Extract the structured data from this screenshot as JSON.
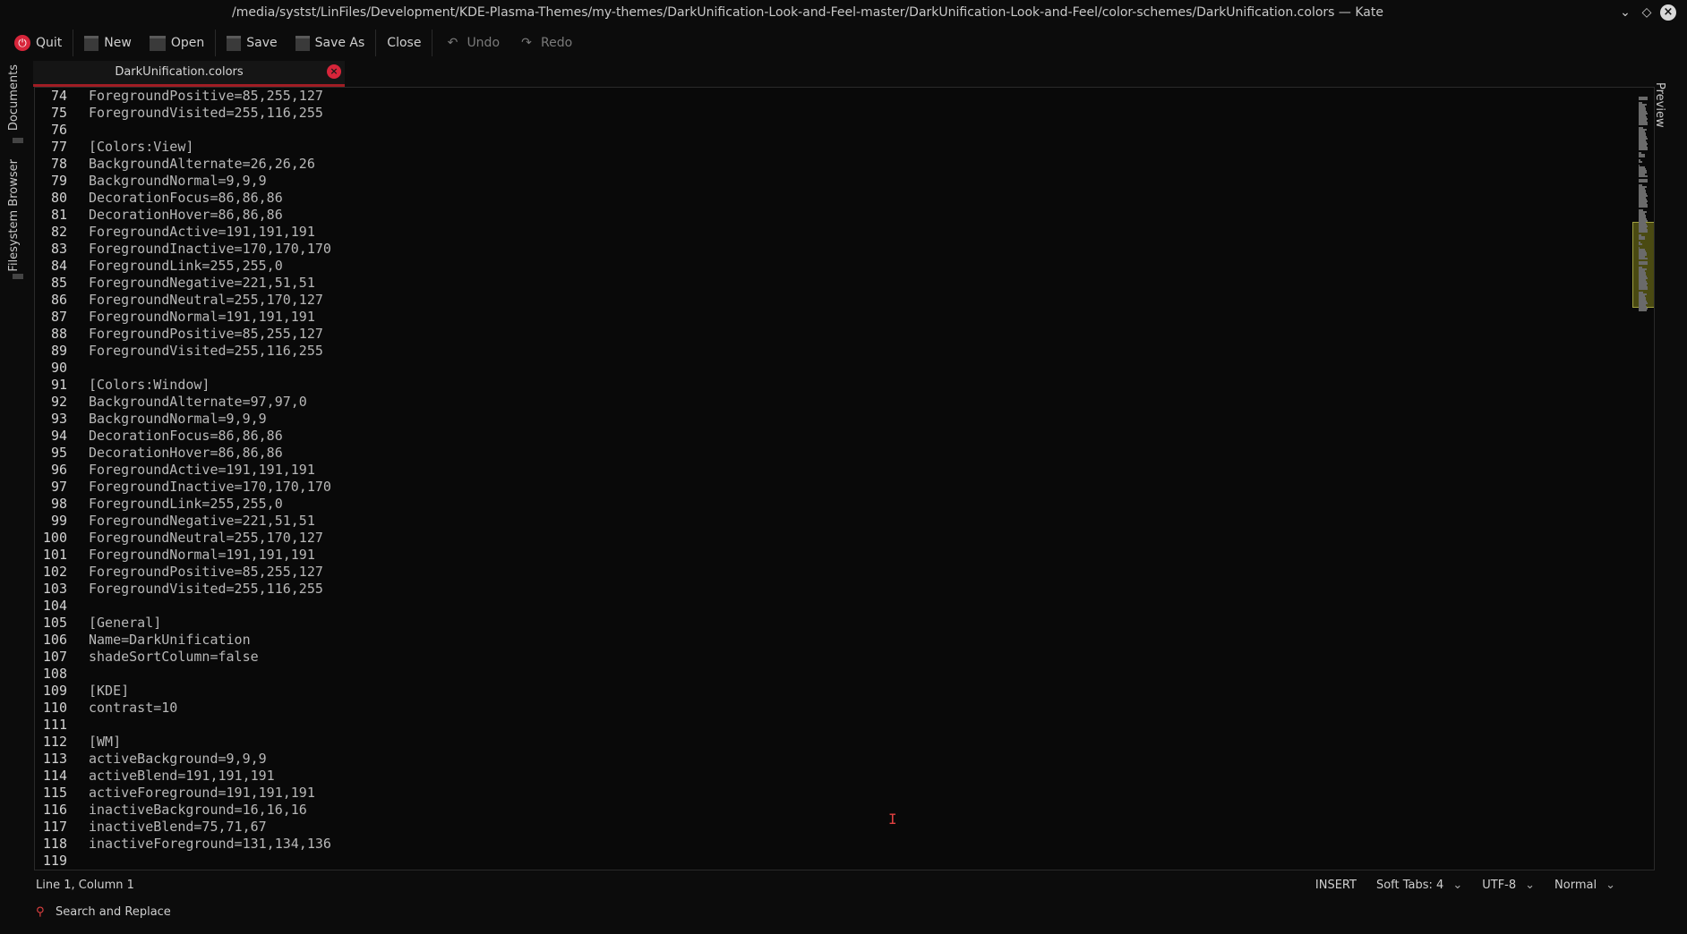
{
  "window": {
    "title": "/media/systst/LinFiles/Development/KDE-Plasma-Themes/my-themes/DarkUnification-Look-and-Feel-master/DarkUnification-Look-and-Feel/color-schemes/DarkUnification.colors — Kate"
  },
  "toolbar": {
    "quit": "Quit",
    "new": "New",
    "open": "Open",
    "save": "Save",
    "save_as": "Save As",
    "close": "Close",
    "undo": "Undo",
    "redo": "Redo"
  },
  "left_panel": {
    "documents": "Documents",
    "filesystem": "Filesystem Browser"
  },
  "right_panel": {
    "preview": "Preview"
  },
  "tab": {
    "label": "DarkUnification.colors"
  },
  "editor": {
    "lines": [
      {
        "n": "74",
        "t": "ForegroundPositive=85,255,127"
      },
      {
        "n": "75",
        "t": "ForegroundVisited=255,116,255"
      },
      {
        "n": "76",
        "t": ""
      },
      {
        "n": "77",
        "t": "[Colors:View]"
      },
      {
        "n": "78",
        "t": "BackgroundAlternate=26,26,26"
      },
      {
        "n": "79",
        "t": "BackgroundNormal=9,9,9"
      },
      {
        "n": "80",
        "t": "DecorationFocus=86,86,86"
      },
      {
        "n": "81",
        "t": "DecorationHover=86,86,86"
      },
      {
        "n": "82",
        "t": "ForegroundActive=191,191,191"
      },
      {
        "n": "83",
        "t": "ForegroundInactive=170,170,170"
      },
      {
        "n": "84",
        "t": "ForegroundLink=255,255,0"
      },
      {
        "n": "85",
        "t": "ForegroundNegative=221,51,51"
      },
      {
        "n": "86",
        "t": "ForegroundNeutral=255,170,127"
      },
      {
        "n": "87",
        "t": "ForegroundNormal=191,191,191"
      },
      {
        "n": "88",
        "t": "ForegroundPositive=85,255,127"
      },
      {
        "n": "89",
        "t": "ForegroundVisited=255,116,255"
      },
      {
        "n": "90",
        "t": ""
      },
      {
        "n": "91",
        "t": "[Colors:Window]"
      },
      {
        "n": "92",
        "t": "BackgroundAlternate=97,97,0"
      },
      {
        "n": "93",
        "t": "BackgroundNormal=9,9,9"
      },
      {
        "n": "94",
        "t": "DecorationFocus=86,86,86"
      },
      {
        "n": "95",
        "t": "DecorationHover=86,86,86"
      },
      {
        "n": "96",
        "t": "ForegroundActive=191,191,191"
      },
      {
        "n": "97",
        "t": "ForegroundInactive=170,170,170"
      },
      {
        "n": "98",
        "t": "ForegroundLink=255,255,0"
      },
      {
        "n": "99",
        "t": "ForegroundNegative=221,51,51"
      },
      {
        "n": "100",
        "t": "ForegroundNeutral=255,170,127"
      },
      {
        "n": "101",
        "t": "ForegroundNormal=191,191,191"
      },
      {
        "n": "102",
        "t": "ForegroundPositive=85,255,127"
      },
      {
        "n": "103",
        "t": "ForegroundVisited=255,116,255"
      },
      {
        "n": "104",
        "t": ""
      },
      {
        "n": "105",
        "t": "[General]"
      },
      {
        "n": "106",
        "t": "Name=DarkUnification"
      },
      {
        "n": "107",
        "t": "shadeSortColumn=false"
      },
      {
        "n": "108",
        "t": ""
      },
      {
        "n": "109",
        "t": "[KDE]"
      },
      {
        "n": "110",
        "t": "contrast=10"
      },
      {
        "n": "111",
        "t": ""
      },
      {
        "n": "112",
        "t": "[WM]"
      },
      {
        "n": "113",
        "t": "activeBackground=9,9,9"
      },
      {
        "n": "114",
        "t": "activeBlend=191,191,191"
      },
      {
        "n": "115",
        "t": "activeForeground=191,191,191"
      },
      {
        "n": "116",
        "t": "inactiveBackground=16,16,16"
      },
      {
        "n": "117",
        "t": "inactiveBlend=75,71,67"
      },
      {
        "n": "118",
        "t": "inactiveForeground=131,134,136"
      },
      {
        "n": "119",
        "t": ""
      }
    ]
  },
  "status": {
    "position": "Line 1, Column 1",
    "mode": "INSERT",
    "indent": "Soft Tabs: 4",
    "encoding": "UTF-8",
    "input_mode": "Normal"
  },
  "search": {
    "label": "Search and Replace"
  },
  "colors": {
    "accent": "#d7253a",
    "tab_underline": "#a01d24",
    "minimap_highlight": "#4a4a12"
  }
}
